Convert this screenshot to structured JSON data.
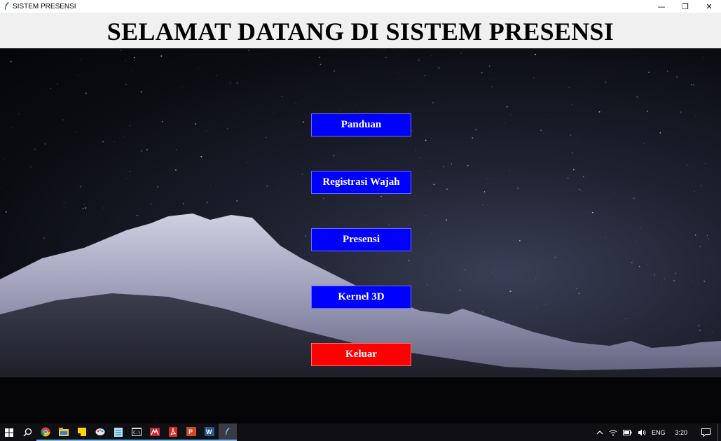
{
  "window": {
    "title": "SISTEM PRESENSI",
    "controls": {
      "minimize": "—",
      "restore": "❐",
      "close": "✕"
    }
  },
  "header": {
    "title": "SELAMAT DATANG DI SISTEM PRESENSI"
  },
  "menu": {
    "buttons": [
      {
        "label": "Panduan",
        "color": "#0000fe"
      },
      {
        "label": "Registrasi Wajah",
        "color": "#0000fe"
      },
      {
        "label": "Presensi",
        "color": "#0000fe"
      },
      {
        "label": "Kernel 3D",
        "color": "#0000fe"
      },
      {
        "label": "Keluar",
        "color": "#fe0000"
      }
    ]
  },
  "taskbar": {
    "apps": [
      "windows-start-icon",
      "search-icon",
      "chrome-icon",
      "file-explorer-icon",
      "sticky-notes-icon",
      "paint-icon",
      "notepad-icon",
      "terminal-icon",
      "matlab-icon",
      "acrobat-icon",
      "powerpoint-icon",
      "word-icon",
      "python-feather-icon"
    ],
    "tray": {
      "language": "ENG",
      "time": "3:20"
    }
  }
}
